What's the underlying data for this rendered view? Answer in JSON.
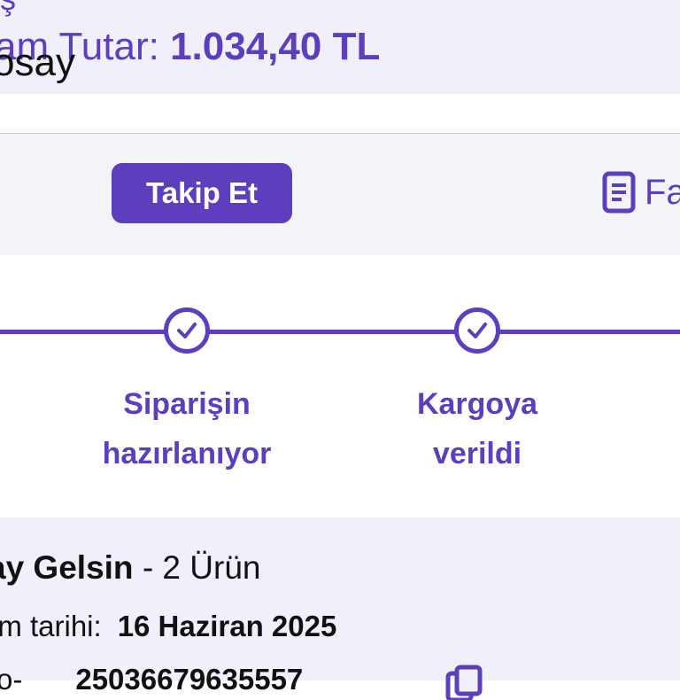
{
  "order_summary": {
    "top_glyph": "ş",
    "total_label": "am Tutar:",
    "total_amount": "1.034,40 TL"
  },
  "seller": {
    "name": "osay",
    "follow_label": "Takip Et",
    "invoice_label": "Fa",
    "invoice_icon": "document-icon"
  },
  "tracker": {
    "steps": [
      {
        "line1": "Siparişin",
        "line2": "hazırlanıyor",
        "done": true
      },
      {
        "line1": "Kargoya",
        "line2": "verildi",
        "done": true
      }
    ]
  },
  "shipment": {
    "title": "ay Gelsin",
    "product_count": "- 2 Ürün",
    "delivery_label": "im tarihi:",
    "delivery_date": "16 Haziran 2025",
    "tracking_label": "o-",
    "tracking_number": "25036679635557",
    "copy_icon": "copy-icon"
  },
  "colors": {
    "accent": "#5d3ebc",
    "panel_lilac": "#f1f0fa",
    "panel_grey": "#f3f4f7",
    "text": "#111111"
  }
}
